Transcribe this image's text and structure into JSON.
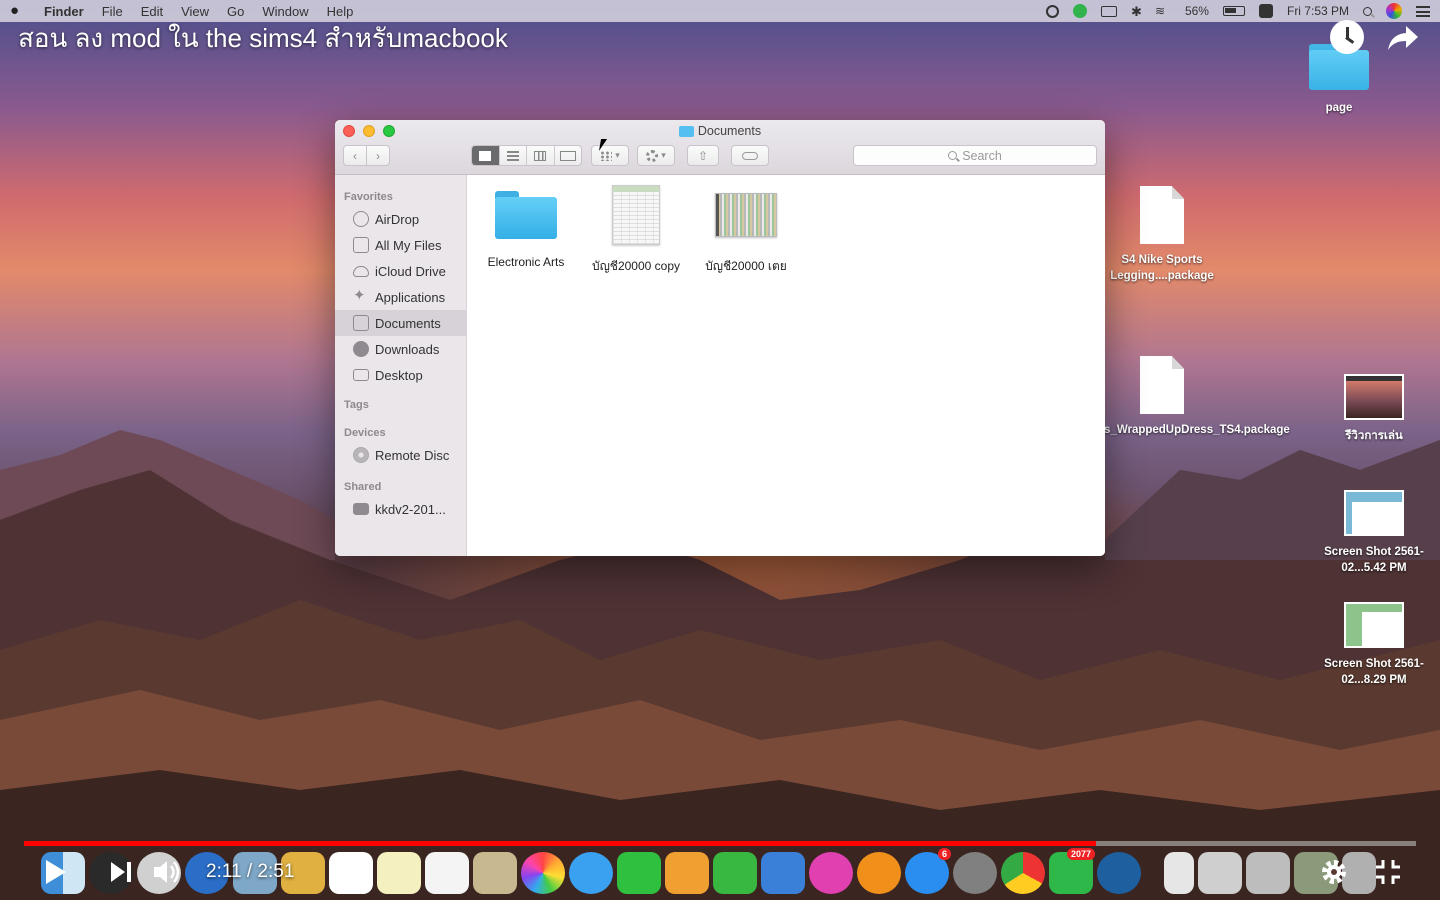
{
  "menubar": {
    "app_name": "Finder",
    "menus": [
      "File",
      "Edit",
      "View",
      "Go",
      "Window",
      "Help"
    ],
    "battery": "56%",
    "clock": "Fri 7:53 PM"
  },
  "video": {
    "title": "สอน ลง mod ใน the sims4 สำหรับmacbook",
    "time": "2:11 / 2:51",
    "progress": 0.77,
    "accent_color": "#ff0000"
  },
  "desktop": {
    "items": [
      {
        "label": "page",
        "kind": "folder"
      },
      {
        "label": "S4 Nike Sports Legging....package",
        "kind": "document"
      },
      {
        "label": "bs_WrappedUpDress_TS4.package",
        "kind": "document"
      },
      {
        "label": "รีวิวการเล่น",
        "kind": "image"
      },
      {
        "label": "Screen Shot 2561-02...5.42 PM",
        "kind": "image"
      },
      {
        "label": "Screen Shot 2561-02...8.29 PM",
        "kind": "image"
      }
    ]
  },
  "finder": {
    "title": "Documents",
    "search_placeholder": "Search",
    "sidebar": {
      "favorites_header": "Favorites",
      "favorites": [
        "AirDrop",
        "All My Files",
        "iCloud Drive",
        "Applications",
        "Documents",
        "Downloads",
        "Desktop"
      ],
      "selected": "Documents",
      "tags_header": "Tags",
      "devices_header": "Devices",
      "devices": [
        "Remote Disc"
      ],
      "shared_header": "Shared",
      "shared": [
        "kkdv2-201..."
      ]
    },
    "files": [
      {
        "name": "Electronic Arts",
        "kind": "folder"
      },
      {
        "name": "บัญชี20000 copy",
        "kind": "spreadsheet"
      },
      {
        "name": "บัญชี20000 เตย",
        "kind": "spreadsheet"
      }
    ]
  },
  "dock": {
    "badges": {
      "appstore": "6",
      "line": "2077"
    }
  }
}
